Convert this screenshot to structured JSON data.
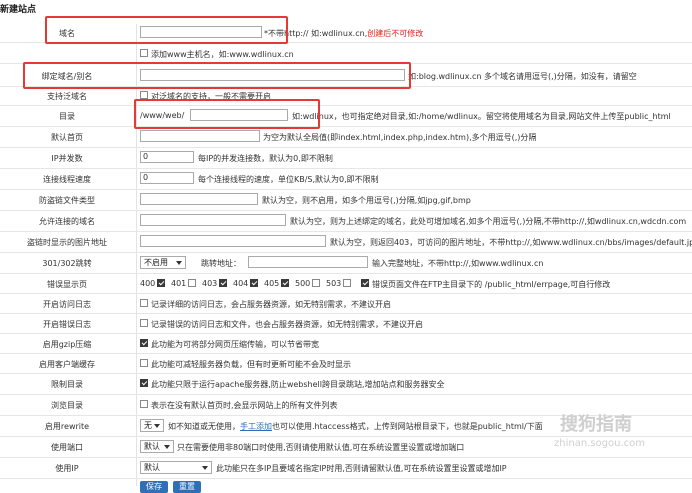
{
  "title": "新建站点",
  "domain": {
    "label": "域名",
    "note": "*不带http:// 如:wdlinux.cn,",
    "note_red": "创建后不可修改"
  },
  "www": {
    "text": "添加www主机名，如:www.wdlinux.cn",
    "checked": false
  },
  "alias": {
    "label": "绑定域名/别名",
    "note": "如:blog.wdlinux.cn 多个域名请用逗号(,)分隔，如没有，请留空"
  },
  "wildcard": {
    "label": "支持泛域名",
    "text": "对泛域名的支持，一般不需要开启",
    "checked": false
  },
  "dir": {
    "label": "目录",
    "prefix": "/www/web/",
    "note": "如:wdlinux，也可指定绝对目录,如:/home/wdlinux。留空将使用域名为目录,网站文件上传至public_html"
  },
  "index": {
    "label": "默认首页",
    "note": "为空为默认全局值(即index.html,index.php,index.htm),多个用逗号(,)分隔"
  },
  "ipcon": {
    "label": "IP并发数",
    "value": "0",
    "note": "每IP的并发连接数，默认为0,即不限制"
  },
  "speed": {
    "label": "连接线程速度",
    "value": "0",
    "note": "每个连接线程的速度，单位KB/S,默认为0,即不限制"
  },
  "hotlink": {
    "label": "防盗链文件类型",
    "note": "默认为空，则不启用，如多个用逗号(,)分隔,如jpg,gif,bmp"
  },
  "allowdom": {
    "label": "允许连接的域名",
    "note": "默认为空，则为上述绑定的域名，此处可增加域名,如多个用逗号(,)分隔,不带http://,如wdlinux.cn,wdcdn.com"
  },
  "hotimg": {
    "label": "盗链时显示的图片地址",
    "note": "默认为空，则返回403，可访问的图片地址，不带http://,如www.wdlinux.cn/bbs/images/default.jpg"
  },
  "redirect": {
    "label": "301/302跳转",
    "select": "不启用",
    "addr_label": "跳转地址：",
    "note": "输入完整地址，不带http://,如www.wdlinux.cn"
  },
  "errpage": {
    "label": "错误显示页",
    "codes": [
      {
        "code": "400",
        "checked": true
      },
      {
        "code": "401",
        "checked": false
      },
      {
        "code": "403",
        "checked": true
      },
      {
        "code": "404",
        "checked": true
      },
      {
        "code": "405",
        "checked": true
      },
      {
        "code": "500",
        "checked": false
      },
      {
        "code": "503",
        "checked": false
      }
    ],
    "err_text": "错误页面文件在FTP主目录下的 /public_html/errpage,可自行修改",
    "err_checked": true
  },
  "accesslog": {
    "label": "开启访问日志",
    "text": "记录详细的访问日志，会占服务器资源，如无特别需求，不建议开启",
    "checked": false
  },
  "errorlog": {
    "label": "开启错误日志",
    "text": "记录错误的访问日志和文件，也会占服务器资源，如无特别需求，不建议开启",
    "checked": false
  },
  "gzip": {
    "label": "启用gzip压缩",
    "text": "此功能为可将部分网页压缩传输，可以节省带宽",
    "checked": true
  },
  "cache": {
    "label": "启用客户端缓存",
    "text": "此功能可减轻服务器负载，但有时更新可能不会及时显示",
    "checked": false
  },
  "limitdir": {
    "label": "限制目录",
    "text": "此功能只限于运行apache服务器,防止webshell跨目录跳站,增加站点和服务器安全",
    "checked": true
  },
  "browse": {
    "label": "浏览目录",
    "text": "表示在没有默认首页时,会显示网站上的所有文件列表",
    "checked": false
  },
  "rewrite": {
    "label": "启用rewrite",
    "select": "无",
    "text1": "如不知道或无使用，",
    "link": "手工添加",
    "text2": "也可以使用.htaccess格式，上传到网站根目录下，也就是public_html/下面"
  },
  "port": {
    "label": "使用端口",
    "select": "默认",
    "text": "只在需要使用非80端口时使用,否则请使用默认值,可在系统设置里设置或增加端口"
  },
  "ip": {
    "label": "使用IP",
    "select": "默认",
    "text": "此功能只在多IP且要域名指定IP时用,否则请留默认值,可在系统设置里设置或增加IP"
  },
  "buttons": {
    "save": "保存",
    "reset": "重置"
  },
  "watermark": {
    "cn": "搜狗指南",
    "url": "zhinan.sogou.com"
  }
}
